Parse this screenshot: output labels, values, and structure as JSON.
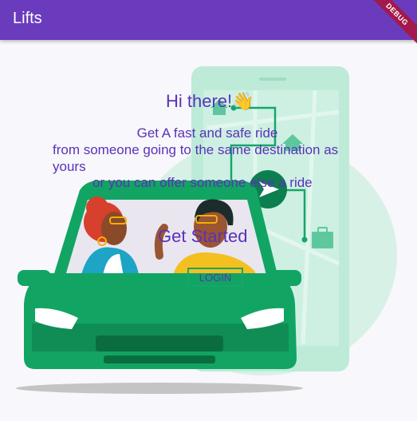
{
  "appbar": {
    "title": "Lifts",
    "debug_banner": "DEBUG"
  },
  "greeting": "Hi there!👋",
  "tagline_line1": "Get A fast and safe ride",
  "tagline_line2": "from someone going to the same destination as yours",
  "tagline_line3": "or you can offer someone else a ride",
  "get_started": "Get Started",
  "login_label": "LOGIN",
  "colors": {
    "appbar": "#6a3bbd",
    "accent_text": "#5a32b8",
    "car_green": "#12a463",
    "phone_mint": "#bdebd8",
    "route_green": "#17a56a"
  }
}
